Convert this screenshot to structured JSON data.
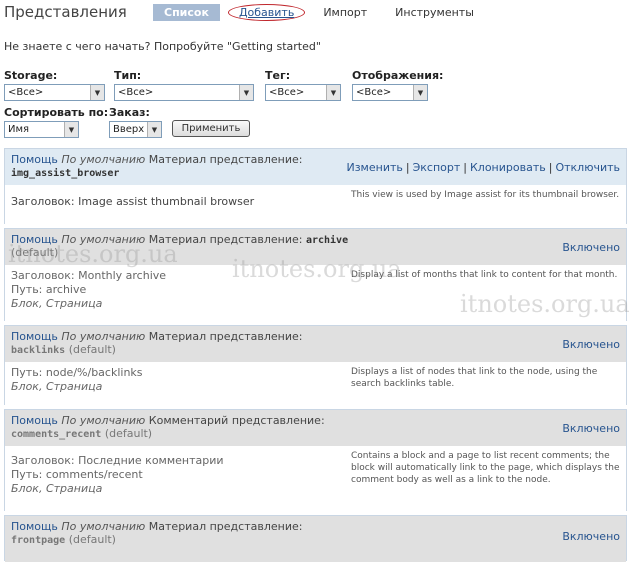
{
  "header": {
    "title": "Представления",
    "tabs": [
      {
        "label": "Список"
      },
      {
        "label": "Добавить"
      },
      {
        "label": "Импорт"
      },
      {
        "label": "Инструменты"
      }
    ]
  },
  "hint": "Не знаете с чего начать? Попробуйте \"Getting started\"",
  "filters": {
    "storage": {
      "label": "Storage:",
      "value": "<Все>"
    },
    "type": {
      "label": "Тип:",
      "value": "<Все>"
    },
    "tag": {
      "label": "Тег:",
      "value": "<Все>"
    },
    "display": {
      "label": "Отображения:",
      "value": "<Все>"
    },
    "sort": {
      "label": "Сортировать по:",
      "value": "Имя"
    },
    "order": {
      "label": "Заказ:",
      "value": "Вверх"
    },
    "apply_label": "Применить"
  },
  "views": [
    {
      "help": "Помощь",
      "default_label": "По умолчанию",
      "kind": "Материал представление:",
      "name": "img_assist_browser",
      "default_tag": "",
      "ops": [
        "Изменить",
        "Экспорт",
        "Клонировать",
        "Отключить"
      ],
      "title": "Заголовок: Image assist thumbnail browser",
      "description": "This view is used by Image assist for its thumbnail browser."
    },
    {
      "help": "Помощь",
      "default_label": "По умолчанию",
      "kind": "Материал представление:",
      "name": "archive",
      "default_tag": "(default)",
      "status": "Включено",
      "title": "Заголовок: Monthly archive",
      "path": "Путь: archive",
      "displays": "Блок, Страница",
      "description": "Display a list of months that link to content for that month."
    },
    {
      "help": "Помощь",
      "default_label": "По умолчанию",
      "kind": "Материал представление:",
      "name": "backlinks",
      "default_tag": "(default)",
      "status": "Включено",
      "path": "Путь: node/%/backlinks",
      "displays": "Блок, Страница",
      "description": "Displays a list of nodes that link to the node, using the search backlinks table."
    },
    {
      "help": "Помощь",
      "default_label": "По умолчанию",
      "kind": "Комментарий представление:",
      "name": "comments_recent",
      "default_tag": "(default)",
      "status": "Включено",
      "title": "Заголовок: Последние комментарии",
      "path": "Путь: comments/recent",
      "displays": "Блок, Страница",
      "description": "Contains a block and a page to list recent comments; the block will automatically link to the page, which displays the comment body as well as a link to the node."
    },
    {
      "help": "Помощь",
      "default_label": "По умолчанию",
      "kind": "Материал представление:",
      "name": "frontpage",
      "default_tag": "(default)",
      "status": "Включено"
    }
  ],
  "watermark": "itnotes.org.ua"
}
